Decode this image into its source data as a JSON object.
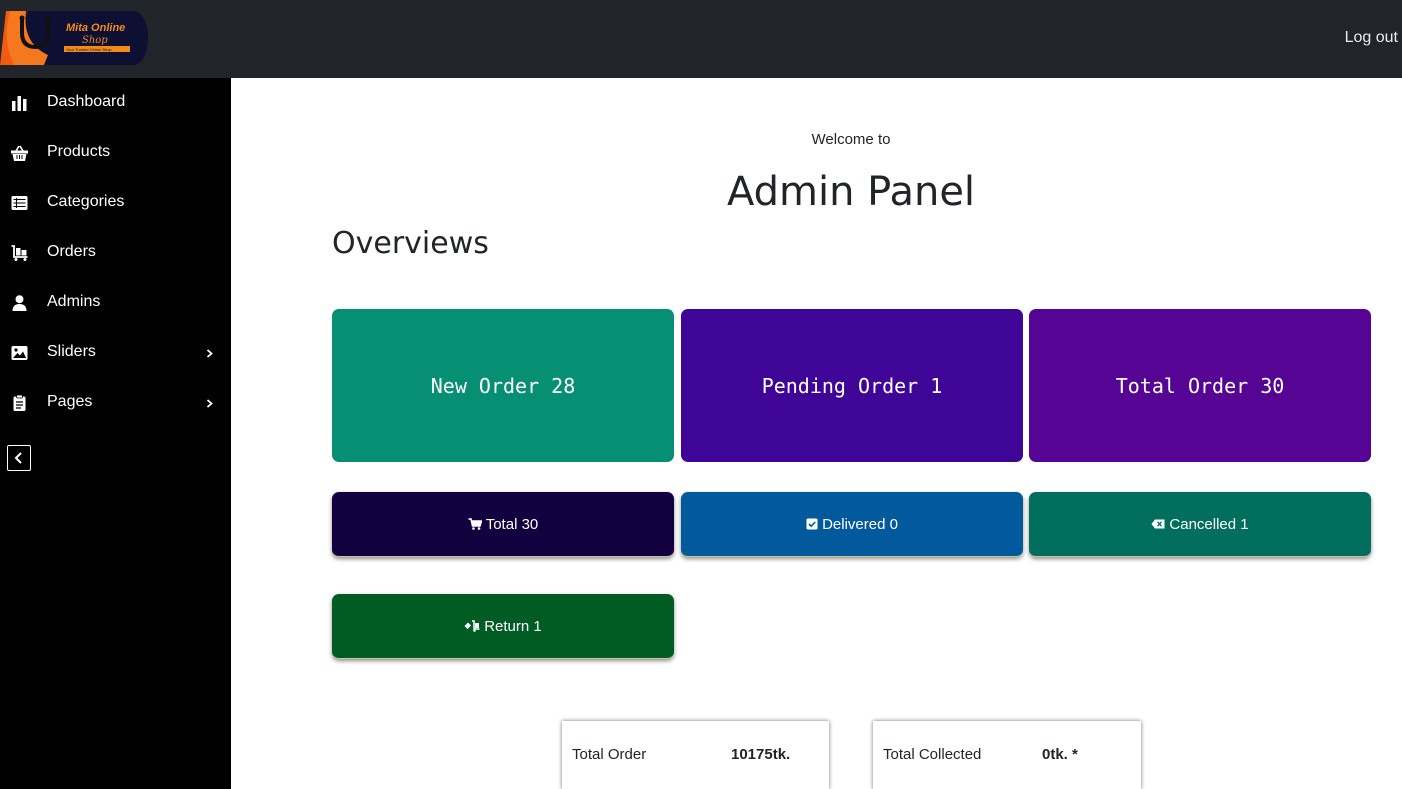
{
  "header": {
    "logo_text": "Mita Online",
    "logo_sub": "Shop",
    "logo_tagline": "Your Trusted Online Shop",
    "logout_label": "Log out"
  },
  "sidebar": {
    "items": [
      {
        "label": "Dashboard",
        "icon": "bar-chart-icon"
      },
      {
        "label": "Products",
        "icon": "basket-icon"
      },
      {
        "label": "Categories",
        "icon": "list-icon"
      },
      {
        "label": "Orders",
        "icon": "luggage-cart-icon"
      },
      {
        "label": "Admins",
        "icon": "user-icon"
      },
      {
        "label": "Sliders",
        "icon": "image-icon",
        "has_submenu": true
      },
      {
        "label": "Pages",
        "icon": "clipboard-icon",
        "has_submenu": true
      }
    ]
  },
  "main": {
    "welcome": "Welcome to",
    "title": "Admin Panel",
    "section_title": "Overviews",
    "big_cards": [
      {
        "label": "New Order 28",
        "color": "#068f73"
      },
      {
        "label": "Pending Order 1",
        "color": "#3f0596"
      },
      {
        "label": "Total Order 30",
        "color": "#560494"
      }
    ],
    "small_cards": [
      {
        "label": "Total 30",
        "icon": "cart-icon",
        "color": "#13003f"
      },
      {
        "label": "Delivered 0",
        "icon": "check-square-icon",
        "color": "#025a9c"
      },
      {
        "label": "Cancelled 1",
        "icon": "backspace-icon",
        "color": "#016e5e"
      },
      {
        "label": "Return 1",
        "icon": "truck-loading-icon",
        "color": "#015c24"
      }
    ],
    "stats": [
      {
        "label": "Total Order",
        "value": "10175tk."
      },
      {
        "label": "Total Collected",
        "value": "0tk. *"
      }
    ]
  }
}
